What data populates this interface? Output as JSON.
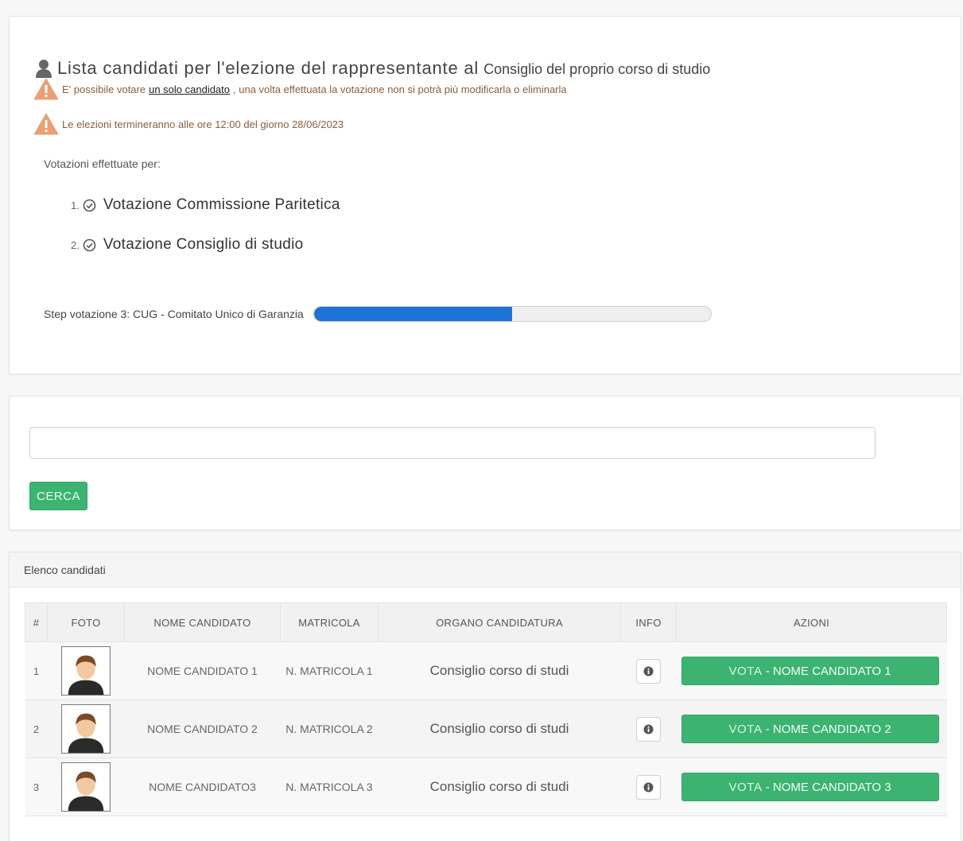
{
  "header": {
    "title_main": "Lista candidati per l'elezione del rappresentante al",
    "title_sub": "Consiglio del proprio corso di studio"
  },
  "warnings": {
    "one_prefix": "E' possibile votare",
    "one_link": "un solo candidato",
    "one_suffix": ", una volta effettuata la votazione non si potrà più modificarla o eliminarla",
    "two": "Le elezioni termineranno alle ore 12:00 del giorno 28/06/2023"
  },
  "votes": {
    "label": "Votazioni effettuate per:",
    "items": [
      {
        "num": "1.",
        "text": "Votazione Commissione Paritetica"
      },
      {
        "num": "2.",
        "text": "Votazione Consiglio di studio"
      }
    ]
  },
  "step": {
    "label": "Step votazione 3: CUG - Comitato Unico di Garanzia",
    "progress_percent": 50,
    "progress_color": "#1e73d9"
  },
  "search": {
    "value": "",
    "placeholder": "",
    "button_label": "CERCA"
  },
  "list": {
    "header": "Elenco candidati",
    "columns": [
      "#",
      "FOTO",
      "NOME CANDIDATO",
      "MATRICOLA",
      "ORGANO CANDIDATURA",
      "INFO",
      "AZIONI"
    ],
    "rows": [
      {
        "idx": "1",
        "name": "NOME CANDIDATO 1",
        "matricola": "N. MATRICOLA 1",
        "organo": "Consiglio corso di studi",
        "vote_prefix": "VOTA",
        "vote_name": "- NOME CANDIDATO 1"
      },
      {
        "idx": "2",
        "name": "NOME CANDIDATO 2",
        "matricola": "N. MATRICOLA 2",
        "organo": "Consiglio corso di studi",
        "vote_prefix": "VOTA",
        "vote_name": "- NOME CANDIDATO 2"
      },
      {
        "idx": "3",
        "name": "NOME CANDIDATO3",
        "matricola": "N. MATRICOLA 3",
        "organo": "Consiglio corso di studi",
        "vote_prefix": "VOTA",
        "vote_name": "- NOME CANDIDATO 3"
      }
    ]
  },
  "colors": {
    "accent_green": "#3cb371",
    "warning_orange": "#e8a075"
  },
  "icons": {
    "title": "user-icon",
    "warning": "warning-triangle-icon",
    "check": "check-circle-icon",
    "info": "info-circle-icon",
    "avatar": "avatar-photo"
  }
}
